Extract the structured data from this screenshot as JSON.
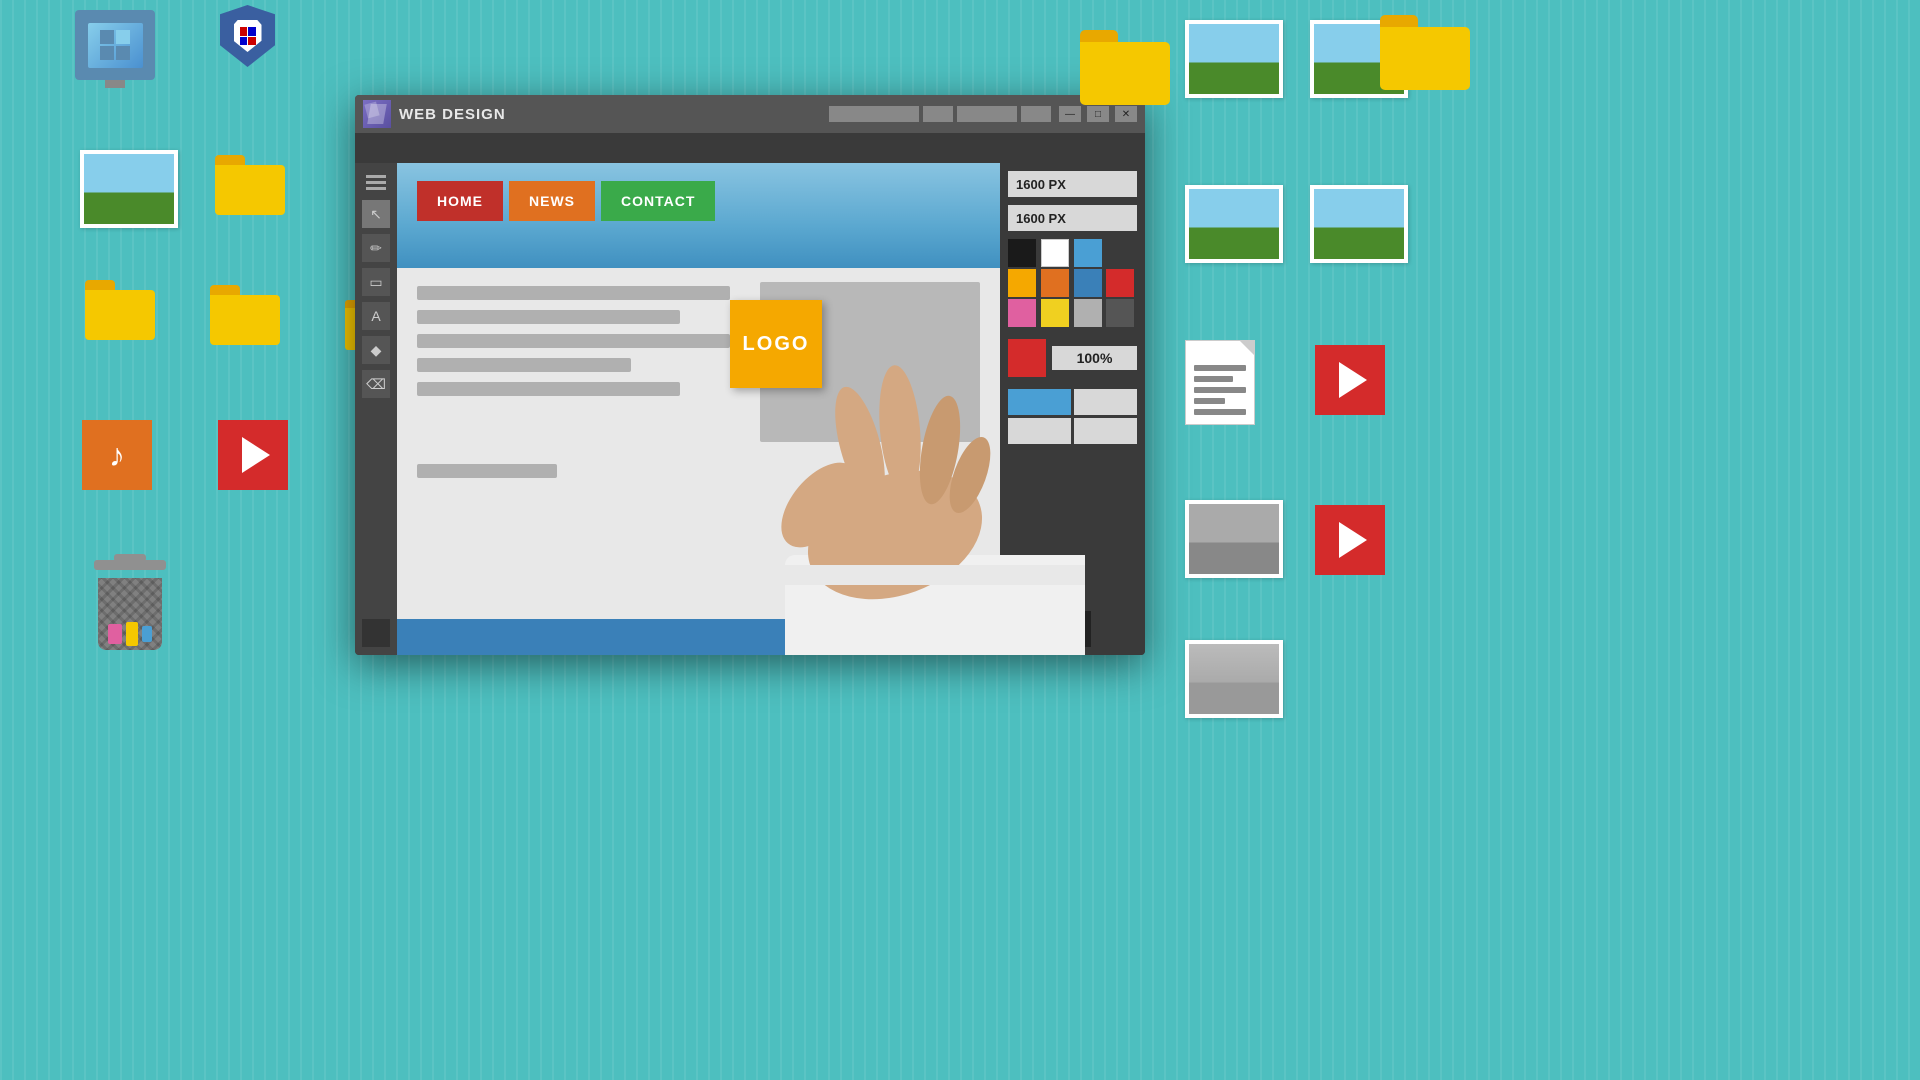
{
  "background": {
    "color": "#4dbfbf"
  },
  "window": {
    "title": "WEB DESIGN",
    "minimize_label": "—",
    "maximize_label": "□",
    "close_label": "✕",
    "width_field": "1600 PX",
    "height_field": "1600 PX",
    "zoom_label": "100%"
  },
  "canvas": {
    "nav_items": [
      "HOME",
      "NEWS",
      "CONTACT"
    ],
    "logo_label": "LOGO"
  },
  "color_swatches": [
    "#1a1a1a",
    "#ffffff",
    "#4a9fd4",
    "#3a3a3a",
    "#f5a800",
    "#e07020",
    "#3a80b8",
    "#d42b2b",
    "#e060a0",
    "#f0d020",
    "#b0b0b0",
    "#555555"
  ],
  "desktop": {
    "left_icons": [
      {
        "name": "monitor-icon",
        "label": ""
      },
      {
        "name": "shield-icon",
        "label": ""
      },
      {
        "name": "folder-yellow-1",
        "label": ""
      },
      {
        "name": "folder-yellow-2",
        "label": ""
      },
      {
        "name": "folder-yellow-3",
        "label": ""
      },
      {
        "name": "photo-card-1",
        "label": ""
      },
      {
        "name": "photo-card-2",
        "label": ""
      },
      {
        "name": "music-icon",
        "label": ""
      },
      {
        "name": "play-icon",
        "label": ""
      },
      {
        "name": "trash-can",
        "label": ""
      }
    ],
    "right_icons": [
      {
        "name": "folder-yellow-large",
        "label": ""
      },
      {
        "name": "photo-card-right-1",
        "label": ""
      },
      {
        "name": "photo-card-right-2",
        "label": ""
      },
      {
        "name": "photo-card-right-3",
        "label": ""
      },
      {
        "name": "doc-lines-icon",
        "label": ""
      },
      {
        "name": "play-icon-right",
        "label": ""
      },
      {
        "name": "photo-bottom-1",
        "label": ""
      },
      {
        "name": "photo-bottom-2",
        "label": ""
      },
      {
        "name": "play-icon-bottom",
        "label": ""
      }
    ]
  },
  "tools": [
    {
      "name": "cursor-tool",
      "symbol": "↖"
    },
    {
      "name": "pencil-tool",
      "symbol": "✏"
    },
    {
      "name": "rectangle-tool",
      "symbol": "□"
    },
    {
      "name": "text-tool",
      "symbol": "A"
    },
    {
      "name": "shape-tool",
      "symbol": "◆"
    },
    {
      "name": "eraser-tool",
      "symbol": "◻"
    },
    {
      "name": "layer-tool",
      "symbol": "▣"
    }
  ]
}
